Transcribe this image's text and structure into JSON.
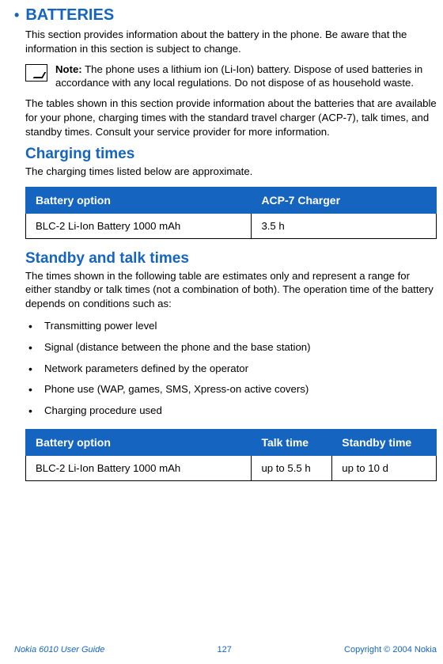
{
  "title": "BATTERIES",
  "intro": "This section provides information about the battery in the phone. Be aware that the information in this section is subject to change.",
  "note_label": "Note:",
  "note_body": " The phone uses a lithium ion (Li-Ion) battery. Dispose of used batteries in accordance with any local regulations. Do not dispose of as household waste.",
  "tables_intro": "The tables shown in this section provide information about the batteries that are available for your phone, charging times with the standard travel charger (ACP-7), talk times, and standby times. Consult your service provider for more information.",
  "charging": {
    "heading": "Charging times",
    "sub": "The charging times listed below are approximate.",
    "headers": {
      "col1": "Battery option",
      "col2": "ACP-7 Charger"
    },
    "row": {
      "c1": "BLC-2 Li-Ion Battery 1000 mAh",
      "c2": "3.5 h"
    }
  },
  "standby": {
    "heading": "Standby and talk times",
    "sub": "The times shown in the following table are estimates only and represent a range for either standby or talk times (not a combination of both). The operation time of the battery depends on conditions such as:",
    "bullets": [
      "Transmitting power level",
      "Signal (distance between the phone and the base station)",
      "Network parameters defined by the operator",
      "Phone use (WAP, games, SMS, Xpress-on active covers)",
      "Charging procedure used"
    ],
    "headers": {
      "col1": "Battery option",
      "col2": "Talk time",
      "col3": "Standby time"
    },
    "row": {
      "c1": "BLC-2 Li-Ion Battery 1000 mAh",
      "c2": "up to 5.5 h",
      "c3": "up to 10 d"
    }
  },
  "footer": {
    "left": "Nokia 6010 User Guide",
    "center": "127",
    "right": "Copyright © 2004 Nokia"
  }
}
